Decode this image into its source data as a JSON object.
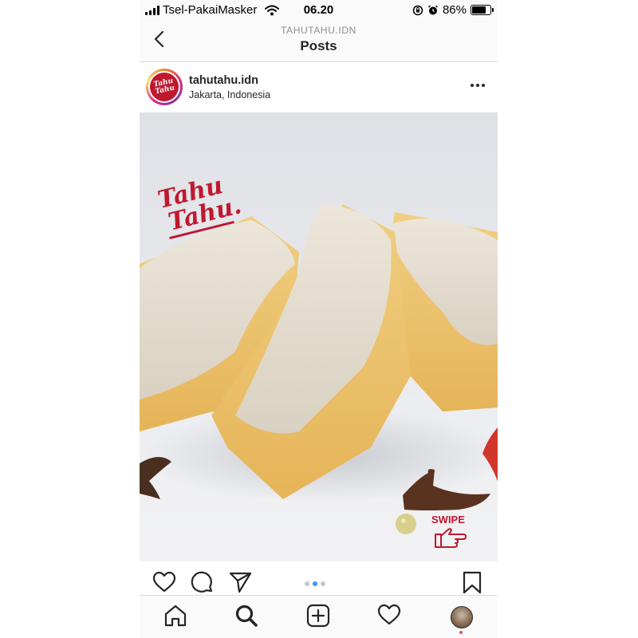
{
  "status_bar": {
    "carrier": "Tsel-PakaiMasker",
    "time": "06.20",
    "battery": "86%",
    "battery_level": 0.86
  },
  "header": {
    "account": "TAHUTAHU.IDN",
    "title": "Posts"
  },
  "post": {
    "username": "tahutahu.idn",
    "location": "Jakarta, Indonesia",
    "avatar_logo_line1": "Tahu",
    "avatar_logo_line2": "Tahu",
    "image": {
      "brand_line1": "Tahu",
      "brand_line2": "Tahu",
      "swipe_label": "SWIPE"
    },
    "carousel": {
      "count": 3,
      "active_index": 1
    }
  },
  "colors": {
    "brand_red": "#c0182f",
    "accent_blue": "#3897f0",
    "notification_red": "#ed4956"
  },
  "icons": {
    "like": "heart-icon",
    "comment": "comment-icon",
    "share": "paper-plane-icon",
    "save": "bookmark-icon",
    "home": "home-icon",
    "search": "search-icon",
    "new_post": "plus-square-icon",
    "activity": "heart-icon",
    "profile": "avatar"
  }
}
